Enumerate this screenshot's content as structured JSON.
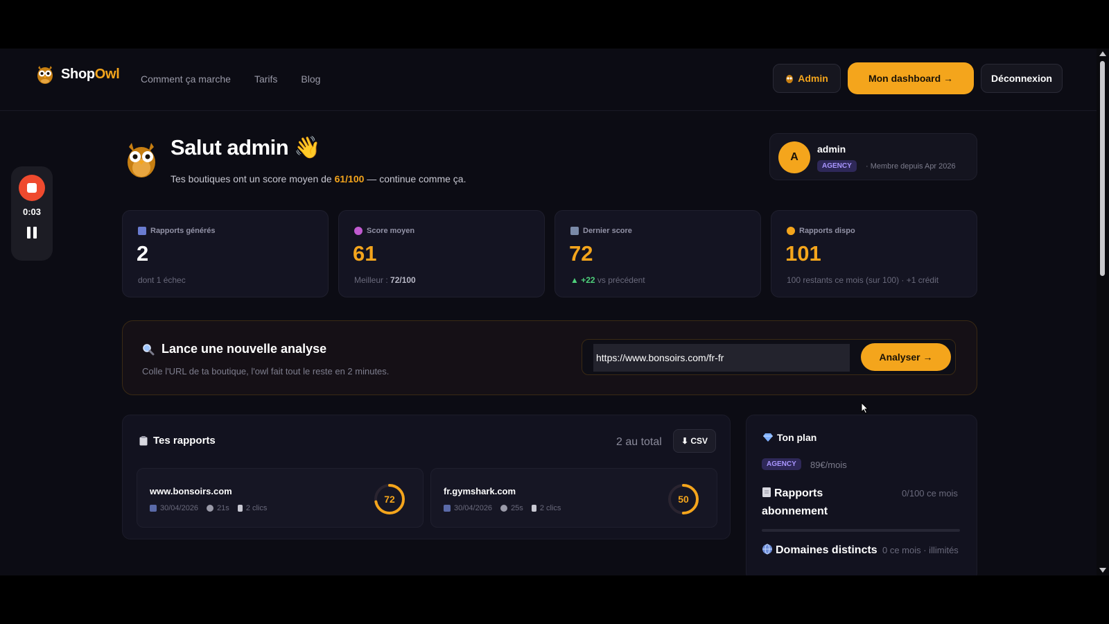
{
  "header": {
    "brand_main": "Shop",
    "brand_accent": "Owl",
    "nav": [
      "Comment ça marche",
      "Tarifs",
      "Blog"
    ],
    "admin_label": "Admin",
    "dashboard_label": "Mon dashboard →",
    "logout_label": "Déconnexion"
  },
  "recorder": {
    "time": "0:03"
  },
  "welcome": {
    "title": "Salut admin",
    "emoji": "👋",
    "sub_before": "Tes boutiques ont un score moyen de ",
    "sub_score": "61/100",
    "sub_after": " — continue comme ça."
  },
  "profile": {
    "initial": "A",
    "name": "admin",
    "plan_badge": "AGENCY",
    "since": "· Membre depuis Apr 2026"
  },
  "stats": [
    {
      "label": "Rapports générés",
      "value": "2",
      "note_before": "dont 1 échec",
      "note_bold": "",
      "note_after": "",
      "value_color": "#ffffff",
      "icon_color": "#6a7cd0"
    },
    {
      "label": "Score moyen",
      "value": "61",
      "note_before": "Meilleur : ",
      "note_bold": "72/100",
      "note_after": "",
      "value_color": "#f4a51c",
      "icon_color": "#c05ad0"
    },
    {
      "label": "Dernier score",
      "value": "72",
      "note_before": "▲ ",
      "note_bold": "+22",
      "note_after": " vs précédent",
      "value_color": "#f4a51c",
      "icon_color": "#7a8aa8"
    },
    {
      "label": "Rapports dispo",
      "value": "101",
      "note_before": "100 restants ce mois (sur 100) · +1 crédit",
      "note_bold": "",
      "note_after": "",
      "value_color": "#f4a51c",
      "icon_color": "#f4a51c"
    }
  ],
  "analyse": {
    "title": "Lance une nouvelle analyse",
    "subtitle": "Colle l'URL de ta boutique, l'owl fait tout le reste en 2 minutes.",
    "input_value": "https://www.bonsoirs.com/fr-fr",
    "button": "Analyser →"
  },
  "reports": {
    "title": "Tes rapports",
    "total": "2 au total",
    "csv": "⬇ CSV",
    "items": [
      {
        "domain": "www.bonsoirs.com",
        "date": "30/04/2026",
        "duration": "21s",
        "clicks": "2 clics",
        "score": 72
      },
      {
        "domain": "fr.gymshark.com",
        "date": "30/04/2026",
        "duration": "25s",
        "clicks": "2 clics",
        "score": 50
      }
    ]
  },
  "plan": {
    "title": "Ton plan",
    "badge": "AGENCY",
    "price": "89€/mois",
    "rows": [
      {
        "label": "Rapports abonnement",
        "value": "0/100 ce mois",
        "fill": 0
      },
      {
        "label": "Domaines distincts",
        "value": "0 ce mois · illimités"
      }
    ]
  },
  "colors": {
    "accent": "#f4a51c",
    "background": "#0c0c14",
    "card": "#141422",
    "badge": "#a996ff"
  }
}
